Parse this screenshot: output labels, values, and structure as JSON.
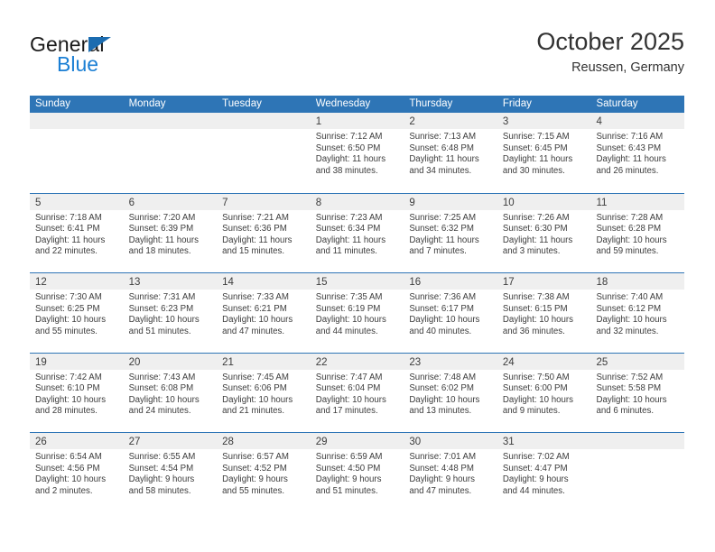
{
  "brand": {
    "name_top": "General",
    "name_bottom": "Blue",
    "accent_color": "#1b7fd4",
    "triangle_color": "#1b6cb0"
  },
  "header": {
    "title": "October 2025",
    "subtitle": "Reussen, Germany"
  },
  "theme": {
    "header_row_bg": "#2e75b6",
    "day_band_bg": "#efefef",
    "week_divider": "#2e75b6",
    "text": "#3c3c3c"
  },
  "weekdays": [
    "Sunday",
    "Monday",
    "Tuesday",
    "Wednesday",
    "Thursday",
    "Friday",
    "Saturday"
  ],
  "weeks": [
    [
      {
        "day": "",
        "lines": []
      },
      {
        "day": "",
        "lines": []
      },
      {
        "day": "",
        "lines": []
      },
      {
        "day": "1",
        "lines": [
          "Sunrise: 7:12 AM",
          "Sunset: 6:50 PM",
          "Daylight: 11 hours",
          "and 38 minutes."
        ]
      },
      {
        "day": "2",
        "lines": [
          "Sunrise: 7:13 AM",
          "Sunset: 6:48 PM",
          "Daylight: 11 hours",
          "and 34 minutes."
        ]
      },
      {
        "day": "3",
        "lines": [
          "Sunrise: 7:15 AM",
          "Sunset: 6:45 PM",
          "Daylight: 11 hours",
          "and 30 minutes."
        ]
      },
      {
        "day": "4",
        "lines": [
          "Sunrise: 7:16 AM",
          "Sunset: 6:43 PM",
          "Daylight: 11 hours",
          "and 26 minutes."
        ]
      }
    ],
    [
      {
        "day": "5",
        "lines": [
          "Sunrise: 7:18 AM",
          "Sunset: 6:41 PM",
          "Daylight: 11 hours",
          "and 22 minutes."
        ]
      },
      {
        "day": "6",
        "lines": [
          "Sunrise: 7:20 AM",
          "Sunset: 6:39 PM",
          "Daylight: 11 hours",
          "and 18 minutes."
        ]
      },
      {
        "day": "7",
        "lines": [
          "Sunrise: 7:21 AM",
          "Sunset: 6:36 PM",
          "Daylight: 11 hours",
          "and 15 minutes."
        ]
      },
      {
        "day": "8",
        "lines": [
          "Sunrise: 7:23 AM",
          "Sunset: 6:34 PM",
          "Daylight: 11 hours",
          "and 11 minutes."
        ]
      },
      {
        "day": "9",
        "lines": [
          "Sunrise: 7:25 AM",
          "Sunset: 6:32 PM",
          "Daylight: 11 hours",
          "and 7 minutes."
        ]
      },
      {
        "day": "10",
        "lines": [
          "Sunrise: 7:26 AM",
          "Sunset: 6:30 PM",
          "Daylight: 11 hours",
          "and 3 minutes."
        ]
      },
      {
        "day": "11",
        "lines": [
          "Sunrise: 7:28 AM",
          "Sunset: 6:28 PM",
          "Daylight: 10 hours",
          "and 59 minutes."
        ]
      }
    ],
    [
      {
        "day": "12",
        "lines": [
          "Sunrise: 7:30 AM",
          "Sunset: 6:25 PM",
          "Daylight: 10 hours",
          "and 55 minutes."
        ]
      },
      {
        "day": "13",
        "lines": [
          "Sunrise: 7:31 AM",
          "Sunset: 6:23 PM",
          "Daylight: 10 hours",
          "and 51 minutes."
        ]
      },
      {
        "day": "14",
        "lines": [
          "Sunrise: 7:33 AM",
          "Sunset: 6:21 PM",
          "Daylight: 10 hours",
          "and 47 minutes."
        ]
      },
      {
        "day": "15",
        "lines": [
          "Sunrise: 7:35 AM",
          "Sunset: 6:19 PM",
          "Daylight: 10 hours",
          "and 44 minutes."
        ]
      },
      {
        "day": "16",
        "lines": [
          "Sunrise: 7:36 AM",
          "Sunset: 6:17 PM",
          "Daylight: 10 hours",
          "and 40 minutes."
        ]
      },
      {
        "day": "17",
        "lines": [
          "Sunrise: 7:38 AM",
          "Sunset: 6:15 PM",
          "Daylight: 10 hours",
          "and 36 minutes."
        ]
      },
      {
        "day": "18",
        "lines": [
          "Sunrise: 7:40 AM",
          "Sunset: 6:12 PM",
          "Daylight: 10 hours",
          "and 32 minutes."
        ]
      }
    ],
    [
      {
        "day": "19",
        "lines": [
          "Sunrise: 7:42 AM",
          "Sunset: 6:10 PM",
          "Daylight: 10 hours",
          "and 28 minutes."
        ]
      },
      {
        "day": "20",
        "lines": [
          "Sunrise: 7:43 AM",
          "Sunset: 6:08 PM",
          "Daylight: 10 hours",
          "and 24 minutes."
        ]
      },
      {
        "day": "21",
        "lines": [
          "Sunrise: 7:45 AM",
          "Sunset: 6:06 PM",
          "Daylight: 10 hours",
          "and 21 minutes."
        ]
      },
      {
        "day": "22",
        "lines": [
          "Sunrise: 7:47 AM",
          "Sunset: 6:04 PM",
          "Daylight: 10 hours",
          "and 17 minutes."
        ]
      },
      {
        "day": "23",
        "lines": [
          "Sunrise: 7:48 AM",
          "Sunset: 6:02 PM",
          "Daylight: 10 hours",
          "and 13 minutes."
        ]
      },
      {
        "day": "24",
        "lines": [
          "Sunrise: 7:50 AM",
          "Sunset: 6:00 PM",
          "Daylight: 10 hours",
          "and 9 minutes."
        ]
      },
      {
        "day": "25",
        "lines": [
          "Sunrise: 7:52 AM",
          "Sunset: 5:58 PM",
          "Daylight: 10 hours",
          "and 6 minutes."
        ]
      }
    ],
    [
      {
        "day": "26",
        "lines": [
          "Sunrise: 6:54 AM",
          "Sunset: 4:56 PM",
          "Daylight: 10 hours",
          "and 2 minutes."
        ]
      },
      {
        "day": "27",
        "lines": [
          "Sunrise: 6:55 AM",
          "Sunset: 4:54 PM",
          "Daylight: 9 hours",
          "and 58 minutes."
        ]
      },
      {
        "day": "28",
        "lines": [
          "Sunrise: 6:57 AM",
          "Sunset: 4:52 PM",
          "Daylight: 9 hours",
          "and 55 minutes."
        ]
      },
      {
        "day": "29",
        "lines": [
          "Sunrise: 6:59 AM",
          "Sunset: 4:50 PM",
          "Daylight: 9 hours",
          "and 51 minutes."
        ]
      },
      {
        "day": "30",
        "lines": [
          "Sunrise: 7:01 AM",
          "Sunset: 4:48 PM",
          "Daylight: 9 hours",
          "and 47 minutes."
        ]
      },
      {
        "day": "31",
        "lines": [
          "Sunrise: 7:02 AM",
          "Sunset: 4:47 PM",
          "Daylight: 9 hours",
          "and 44 minutes."
        ]
      },
      {
        "day": "",
        "lines": []
      }
    ]
  ]
}
